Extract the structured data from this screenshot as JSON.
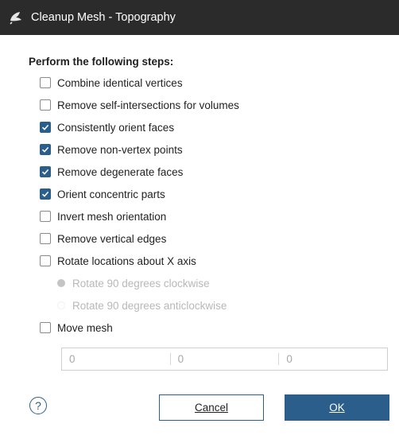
{
  "window": {
    "title": "Cleanup Mesh - Topography",
    "icon": "app-logo-icon"
  },
  "heading": "Perform the following steps:",
  "steps": [
    {
      "label": "Combine identical vertices",
      "checked": false
    },
    {
      "label": "Remove self-intersections for volumes",
      "checked": false
    },
    {
      "label": "Consistently orient faces",
      "checked": true
    },
    {
      "label": "Remove non-vertex points",
      "checked": true
    },
    {
      "label": "Remove degenerate faces",
      "checked": true
    },
    {
      "label": "Orient concentric parts",
      "checked": true
    },
    {
      "label": "Invert mesh orientation",
      "checked": false
    },
    {
      "label": "Remove vertical edges",
      "checked": false
    },
    {
      "label": "Rotate locations about X axis",
      "checked": false
    }
  ],
  "rotation_options": [
    {
      "label": "Rotate 90 degrees clockwise",
      "selected": true,
      "enabled": false
    },
    {
      "label": "Rotate 90 degrees anticlockwise",
      "selected": false,
      "enabled": false
    }
  ],
  "move_mesh": {
    "label": "Move mesh",
    "checked": false,
    "values": [
      "0",
      "0",
      "0"
    ]
  },
  "buttons": {
    "help": "?",
    "cancel": "Cancel",
    "ok": "OK"
  },
  "colors": {
    "accent": "#2b5e8a",
    "titlebar": "#2b2b2b"
  }
}
